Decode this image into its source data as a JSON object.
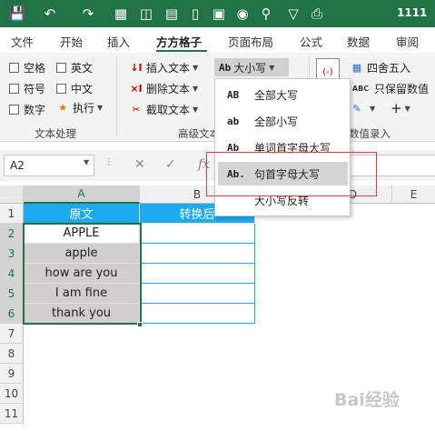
{
  "titlebar": {
    "icons": [
      "save-icon",
      "undo-icon",
      "redo-icon",
      "excel-grid-icon",
      "table-icon",
      "chart-icon",
      "bar-chart-icon",
      "image-icon",
      "camera-icon",
      "search-icon",
      "filter-icon",
      "printer-icon"
    ],
    "title": "1111"
  },
  "tabs": [
    {
      "label": "文件",
      "active": false
    },
    {
      "label": "开始",
      "active": false
    },
    {
      "label": "插入",
      "active": false
    },
    {
      "label": "方方格子",
      "active": true
    },
    {
      "label": "页面布局",
      "active": false
    },
    {
      "label": "公式",
      "active": false
    },
    {
      "label": "数据",
      "active": false
    },
    {
      "label": "审阅",
      "active": false
    }
  ],
  "ribbon": {
    "checkboxes": [
      "空格",
      "英文",
      "符号",
      "中文",
      "数字"
    ],
    "execute_label": "执行",
    "insert_text": "插入文本",
    "delete_text": "删除文本",
    "extract_text": "截取文本",
    "case_button_icon": "Ab",
    "case_button_label": "大小写",
    "round_label": "四舍五入",
    "keep_value_label": "只保留数值",
    "group_text_processing": "文本处理",
    "group_advanced_text": "高级文本",
    "group_data_entry": "数值录入",
    "accent": "#217346"
  },
  "formula_bar": {
    "name_box": "A2",
    "fx": "fx",
    "value": ""
  },
  "menu": {
    "items": [
      {
        "icon": "AB",
        "label": "全部大写"
      },
      {
        "icon": "ab",
        "label": "全部小写"
      },
      {
        "icon": "Ab",
        "label": "单词首字母大写"
      },
      {
        "icon": "Ab.",
        "label": "句首字母大写"
      },
      {
        "icon": "",
        "label": "大小写反转"
      }
    ],
    "highlighted_index": 3
  },
  "sheet": {
    "columns": [
      "A",
      "B",
      "C",
      "D",
      "E"
    ],
    "rows": [
      "1",
      "2",
      "3",
      "4",
      "5",
      "6",
      "7",
      "8",
      "9",
      "10",
      "11"
    ],
    "header_cells": [
      "原文",
      "转换后"
    ],
    "data": [
      "APPLE",
      "apple",
      "how are you",
      "I am fine",
      "thank you"
    ],
    "header_fill": "#1eaaf1",
    "data_fill": "#d0cece"
  },
  "watermark": "Bai经验"
}
